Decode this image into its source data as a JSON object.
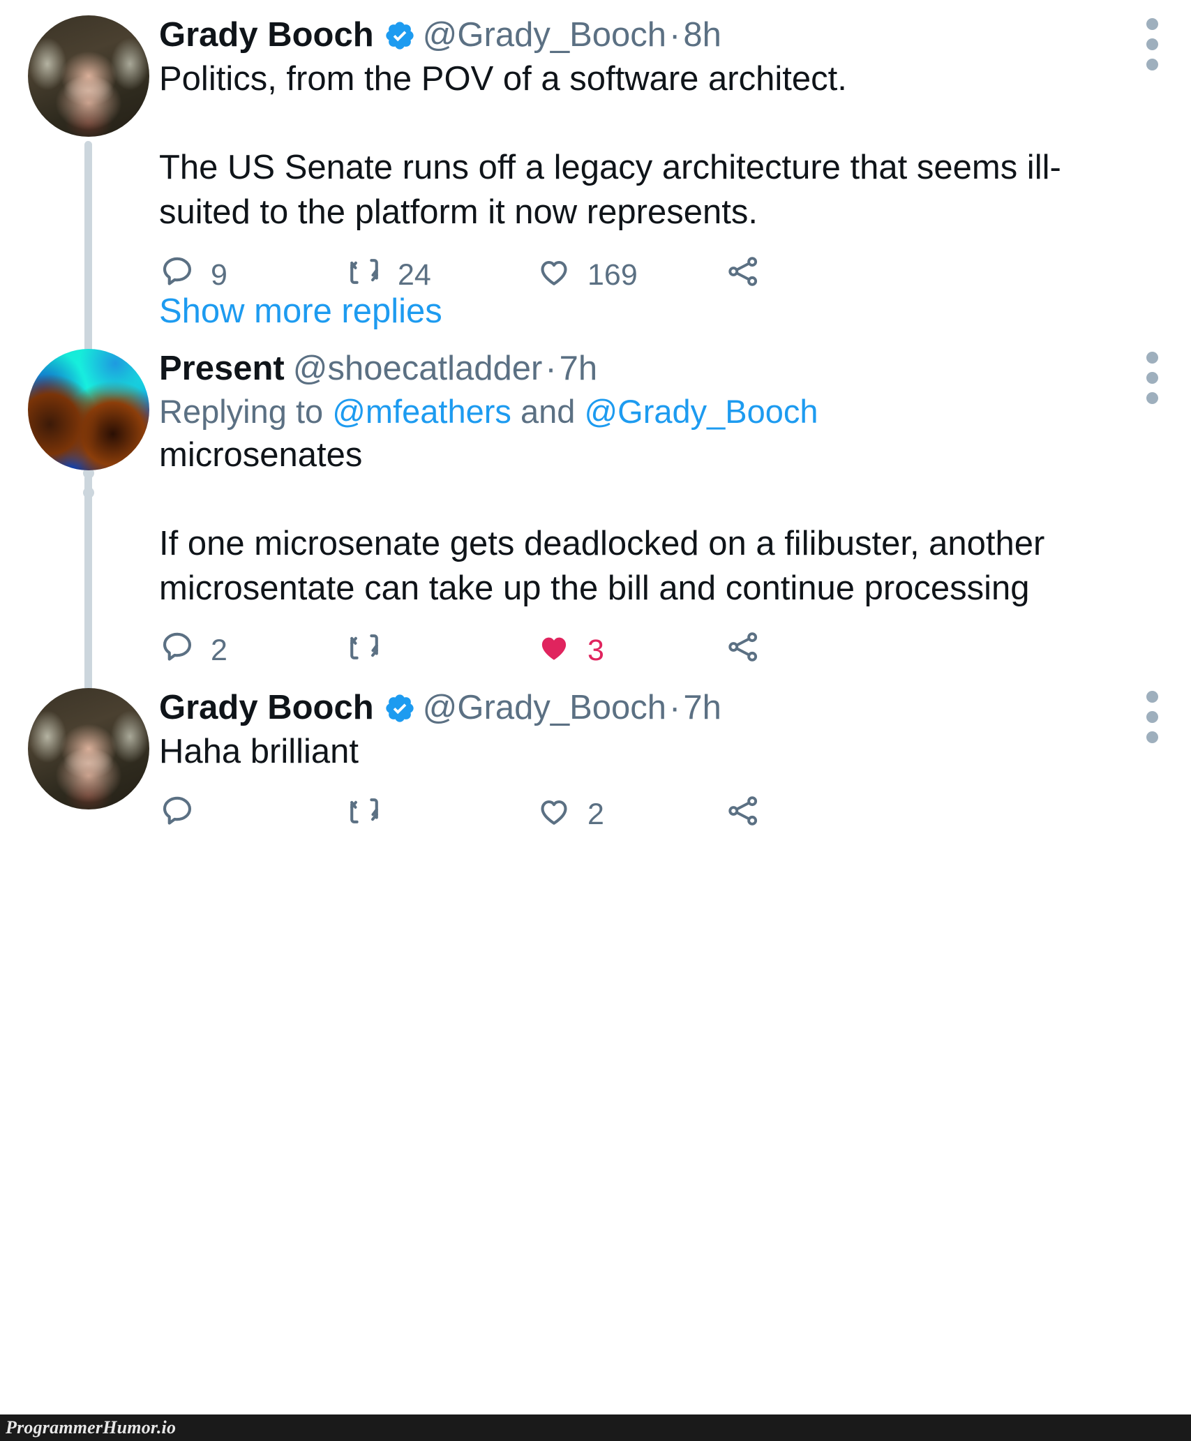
{
  "watermark": {
    "text": "ProgrammerHumor.io"
  },
  "thread": {
    "show_more_label": "Show more replies",
    "tweets": [
      {
        "id": "tweet-1",
        "display_name": "Grady Booch",
        "verified": true,
        "handle": "@Grady_Booch",
        "separator": "·",
        "timestamp": "8h",
        "replying_to_prefix": "",
        "replying_to": [],
        "text": "Politics, from the POV of a software architect.\n\nThe US Senate runs off a legacy architecture that seems ill-suited to the platform it now represents.",
        "actions": {
          "reply": {
            "icon": "reply-icon",
            "count": "9"
          },
          "retweet": {
            "icon": "retweet-icon",
            "count": "24"
          },
          "like": {
            "icon": "heart-icon",
            "count": "169",
            "liked": false
          },
          "share": {
            "icon": "share-icon",
            "count": ""
          }
        },
        "more_icon": "more-options-icon"
      },
      {
        "id": "tweet-2",
        "display_name": "Present",
        "verified": false,
        "handle": "@shoecatladder",
        "separator": "·",
        "timestamp": "7h",
        "replying_to_prefix": "Replying to ",
        "replying_to": [
          "@mfeathers",
          "@Grady_Booch"
        ],
        "replying_to_joiner": " and ",
        "text": "microsenates\n\nIf one microsenate gets deadlocked on a filibuster, another microsentate can take up the bill and continue processing",
        "actions": {
          "reply": {
            "icon": "reply-icon",
            "count": "2"
          },
          "retweet": {
            "icon": "retweet-icon",
            "count": ""
          },
          "like": {
            "icon": "heart-icon",
            "count": "3",
            "liked": true
          },
          "share": {
            "icon": "share-icon",
            "count": ""
          }
        },
        "more_icon": "more-options-icon"
      },
      {
        "id": "tweet-3",
        "display_name": "Grady Booch",
        "verified": true,
        "handle": "@Grady_Booch",
        "separator": "·",
        "timestamp": "7h",
        "replying_to_prefix": "",
        "replying_to": [],
        "text": "Haha brilliant",
        "actions": {
          "reply": {
            "icon": "reply-icon",
            "count": ""
          },
          "retweet": {
            "icon": "retweet-icon",
            "count": ""
          },
          "like": {
            "icon": "heart-icon",
            "count": "2",
            "liked": false
          },
          "share": {
            "icon": "share-icon",
            "count": ""
          }
        },
        "more_icon": "more-options-icon"
      }
    ]
  },
  "colors": {
    "verified_blue": "#1d9bf0",
    "link_blue": "#1d9bf0",
    "muted": "#5b7083",
    "liked_red": "#e0245e",
    "thread_line": "#ccd6dd",
    "text": "#0f1419"
  }
}
